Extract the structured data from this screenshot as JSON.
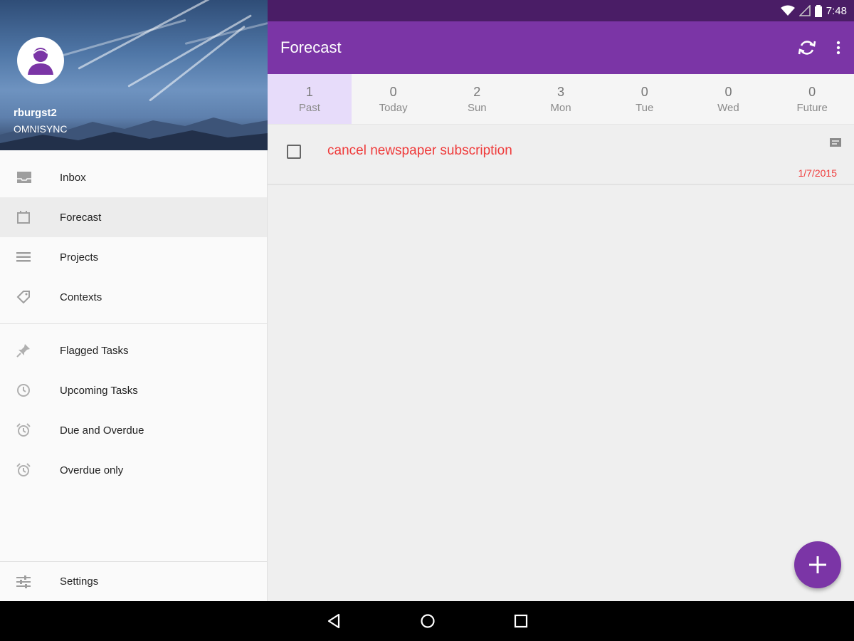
{
  "status_bar": {
    "time": "7:48"
  },
  "drawer": {
    "account": {
      "name": "rburgst2",
      "server": "OMNISYNC"
    },
    "items_primary": [
      {
        "label": "Inbox",
        "icon": "inbox-icon"
      },
      {
        "label": "Forecast",
        "icon": "calendar-icon",
        "active": true
      },
      {
        "label": "Projects",
        "icon": "list-icon"
      },
      {
        "label": "Contexts",
        "icon": "tag-icon"
      }
    ],
    "items_secondary": [
      {
        "label": "Flagged Tasks",
        "icon": "pin-icon"
      },
      {
        "label": "Upcoming Tasks",
        "icon": "clock-icon"
      },
      {
        "label": "Due and Overdue",
        "icon": "alarm-icon"
      },
      {
        "label": "Overdue only",
        "icon": "alarm-icon"
      }
    ],
    "settings_label": "Settings"
  },
  "toolbar": {
    "title": "Forecast"
  },
  "tabs": [
    {
      "count": "1",
      "label": "Past",
      "active": true
    },
    {
      "count": "0",
      "label": "Today"
    },
    {
      "count": "2",
      "label": "Sun"
    },
    {
      "count": "3",
      "label": "Mon"
    },
    {
      "count": "0",
      "label": "Tue"
    },
    {
      "count": "0",
      "label": "Wed"
    },
    {
      "count": "0",
      "label": "Future"
    }
  ],
  "tasks": [
    {
      "title": "cancel newspaper subscription",
      "date": "1/7/2015"
    }
  ],
  "colors": {
    "accent": "#7b35a6",
    "status_bar": "#4a1d66",
    "overdue": "#ef3b3b",
    "active_tab": "#e7dcfa"
  }
}
